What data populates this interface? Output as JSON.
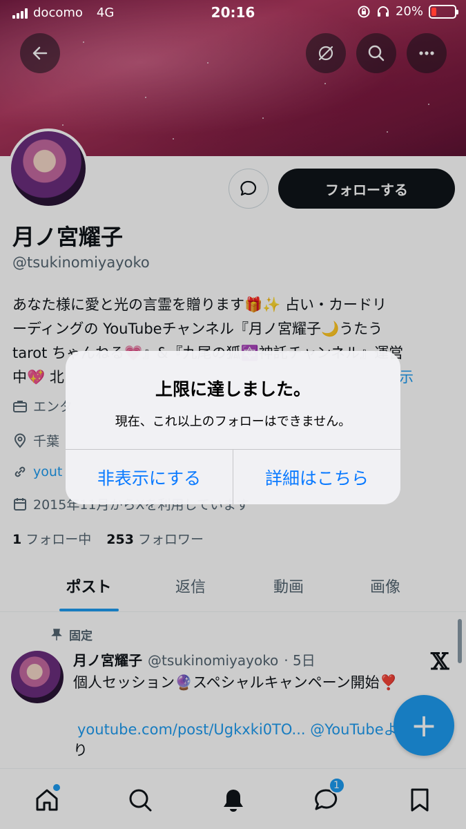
{
  "status_bar": {
    "carrier": "docomo",
    "network": "4G",
    "time": "20:16",
    "battery": "20%"
  },
  "profile": {
    "display_name": "月ノ宮耀子",
    "handle": "@tsukinomiyayoko",
    "follow_label": "フォローする",
    "bio_line1": "あなた様に愛と光の言霊を贈ります🎁✨ 占い・カードリ",
    "bio_line2": "ーディングの YouTubeチャンネル『月ノ宮耀子🌙うたう",
    "bio_line3": "tarot ちゃんねる💗』&『九尾の狐🔯神託チャンネル』運営",
    "bio_line4": "中💖 北",
    "bio_more": "示",
    "category_partial": "エンタ",
    "location_partial": "千葉",
    "link_partial": "yout",
    "joined": "2015年11月からXを利用しています",
    "following_count": "1",
    "following_label": "フォロー中",
    "followers_count": "253",
    "followers_label": "フォロワー"
  },
  "tabs": [
    {
      "label": "ポスト"
    },
    {
      "label": "返信"
    },
    {
      "label": "動画"
    },
    {
      "label": "画像"
    }
  ],
  "post": {
    "pinned_label": "固定",
    "author_name": "月ノ宮耀子",
    "author_handle": "@tsukinomiyayoko",
    "age": "· 5日",
    "text": "個人セッション🔮スペシャルキャンペーン開始❣️",
    "link": "youtube.com/post/Ugkxki0TO... @YouTubeよ",
    "text2": "り"
  },
  "bottom_nav": {
    "messages_badge": "1"
  },
  "alert": {
    "title": "上限に達しました。",
    "message": "現在、これ以上のフォローはできません。",
    "dismiss_label": "非表示にする",
    "learn_more_label": "詳細はこちら"
  },
  "colors": {
    "accent": "#1d9bf0",
    "alert_button": "#0a7aff",
    "follow_button": "#0f1419"
  }
}
